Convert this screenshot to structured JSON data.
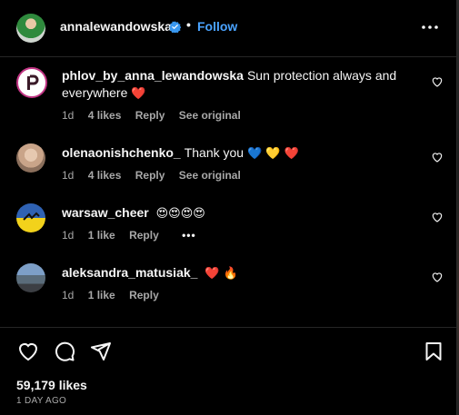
{
  "header": {
    "username": "annalewandowska",
    "separator": "•",
    "follow_label": "Follow",
    "verified_icon": "verified-badge-icon",
    "more_icon": "more-horizontal-icon"
  },
  "comments": [
    {
      "username": "phlov_by_anna_lewandowska",
      "text": "Sun protection always and everywhere",
      "emoji": "❤️",
      "time": "1d",
      "likes": "4 likes",
      "reply": "Reply",
      "see_original": "See original"
    },
    {
      "username": "olenaonishchenko_",
      "text": "Thank you",
      "emoji": "💙 💛 ❤️",
      "time": "1d",
      "likes": "4 likes",
      "reply": "Reply",
      "see_original": "See original"
    },
    {
      "username": "warsaw_cheer",
      "text": "",
      "emoji": "😍😍😍😍",
      "time": "1d",
      "likes": "1 like",
      "reply": "Reply",
      "more": "•••"
    },
    {
      "username": "aleksandra_matusiak_",
      "text": "",
      "emoji": "❤️ 🔥",
      "time": "1d",
      "likes": "1 like",
      "reply": "Reply"
    }
  ],
  "footer": {
    "likes": "59,179 likes",
    "time_ago": "1 DAY AGO"
  },
  "colors": {
    "background": "#000000",
    "text": "#f5f5f5",
    "muted": "#a8a8a8",
    "link": "#4aa3ff",
    "heart": "#ff3040"
  }
}
